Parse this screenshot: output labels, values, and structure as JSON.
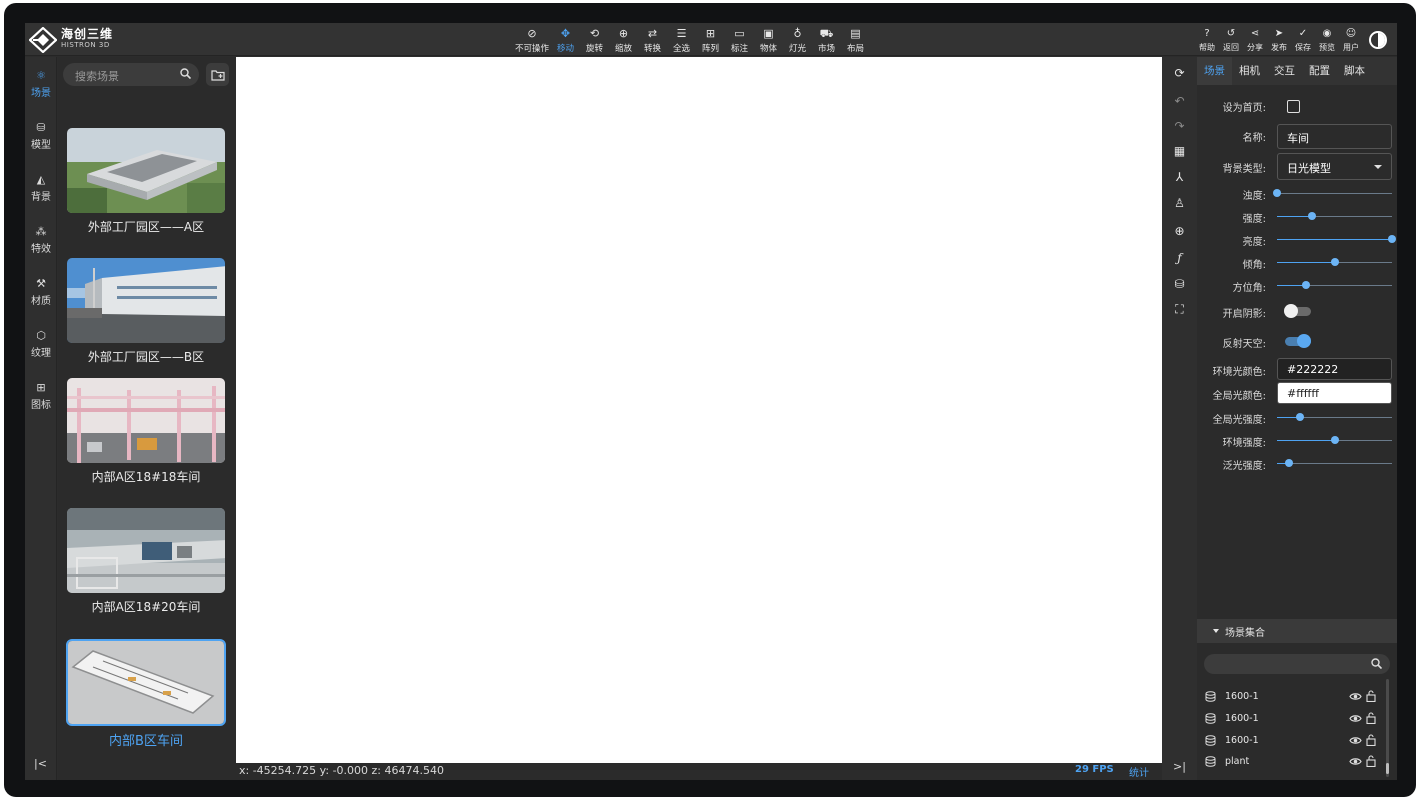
{
  "app": {
    "logo_cn": "海创三维",
    "logo_en": "HISTRON 3D",
    "accent_color": "#4ea3f2"
  },
  "toolbar": [
    {
      "label": "不可操作",
      "icon": "ban-icon"
    },
    {
      "label": "移动",
      "icon": "move-icon",
      "active": true
    },
    {
      "label": "旋转",
      "icon": "rotate-icon"
    },
    {
      "label": "缩放",
      "icon": "zoom-icon"
    },
    {
      "label": "转换",
      "icon": "convert-icon"
    },
    {
      "label": "全选",
      "icon": "select-all-icon"
    },
    {
      "label": "阵列",
      "icon": "array-icon"
    },
    {
      "label": "标注",
      "icon": "annotate-icon"
    },
    {
      "label": "物体",
      "icon": "object-icon"
    },
    {
      "label": "灯光",
      "icon": "light-icon"
    },
    {
      "label": "市场",
      "icon": "cart-icon"
    },
    {
      "label": "布局",
      "icon": "layout-icon"
    }
  ],
  "right_toolbar": [
    {
      "label": "帮助",
      "icon": "help-icon"
    },
    {
      "label": "返回",
      "icon": "back-icon"
    },
    {
      "label": "分享",
      "icon": "share-icon"
    },
    {
      "label": "发布",
      "icon": "publish-icon"
    },
    {
      "label": "保存",
      "icon": "save-icon"
    },
    {
      "label": "预览",
      "icon": "preview-icon"
    },
    {
      "label": "用户",
      "icon": "user-icon"
    }
  ],
  "left_nav": [
    {
      "label": "场景",
      "icon": "scene-icon",
      "active": true
    },
    {
      "label": "模型",
      "icon": "model-icon"
    },
    {
      "label": "背景",
      "icon": "background-icon"
    },
    {
      "label": "特效",
      "icon": "effects-icon"
    },
    {
      "label": "材质",
      "icon": "material-icon"
    },
    {
      "label": "纹理",
      "icon": "texture-icon"
    },
    {
      "label": "图标",
      "icon": "icons-icon"
    }
  ],
  "scene_panel": {
    "search_placeholder": "搜索场景",
    "scenes": [
      {
        "title": "外部工厂园区——A区"
      },
      {
        "title": "外部工厂园区——B区"
      },
      {
        "title": "内部A区18#18车间"
      },
      {
        "title": "内部A区18#20车间"
      },
      {
        "title": "内部B区车间",
        "selected": true
      }
    ]
  },
  "status": {
    "coords": "x: -45254.725 y: -0.000 z: 46474.540",
    "fps": "29 FPS",
    "stats": "统计"
  },
  "props": {
    "tabs": [
      "场景",
      "相机",
      "交互",
      "配置",
      "脚本"
    ],
    "active_tab": "场景",
    "set_home_label": "设为首页:",
    "set_home_checked": false,
    "name_label": "名称:",
    "name_value": "车间",
    "bg_type_label": "背景类型:",
    "bg_type_value": "日光模型",
    "turbidity_label": "浊度:",
    "turbidity_value": 0.0,
    "intensity_label": "强度:",
    "intensity_value": 0.3,
    "brightness_label": "亮度:",
    "brightness_value": 1.0,
    "inclination_label": "倾角:",
    "inclination_value": 0.5,
    "azimuth_label": "方位角:",
    "azimuth_value": 0.25,
    "shadow_label": "开启阴影:",
    "shadow_on": false,
    "reflect_sky_label": "反射天空:",
    "reflect_sky_on": true,
    "ambient_color_label": "环境光颜色:",
    "ambient_color_value": "#222222",
    "global_color_label": "全局光颜色:",
    "global_color_value": "#ffffff",
    "global_intensity_label": "全局光强度:",
    "global_intensity_value": 0.2,
    "env_intensity_label": "环境强度:",
    "env_intensity_value": 0.5,
    "flood_intensity_label": "泛光强度:",
    "flood_intensity_value": 0.1,
    "collection_title": "场景集合",
    "collection_items": [
      "1600-1",
      "1600-1",
      "1600-1",
      "plant"
    ]
  }
}
